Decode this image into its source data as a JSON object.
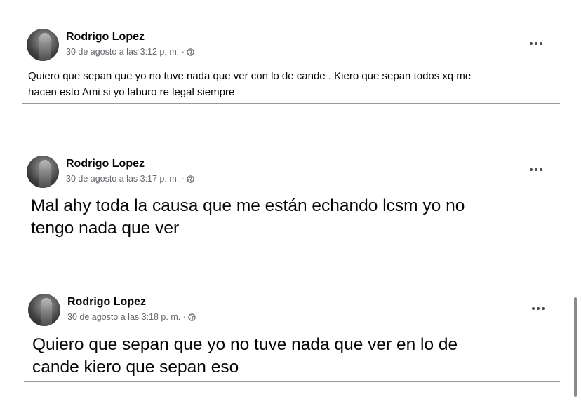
{
  "posts": [
    {
      "author": "Rodrigo Lopez",
      "timestamp": "30 de agosto a las 3:12 p. m. ·",
      "privacy_icon": "globe-icon",
      "text_line1": "Quiero que sepan que yo no tuve nada que ver con lo de cande . Kiero que sepan todos xq me",
      "text_line2": "hacen esto Ami si yo laburo re legal siempre"
    },
    {
      "author": "Rodrigo Lopez",
      "timestamp": "30 de agosto a las 3:17 p. m. ·",
      "privacy_icon": "globe-icon",
      "text_line1": "Mal ahy toda la causa que me están echando lcsm yo no",
      "text_line2": "tengo nada que ver"
    },
    {
      "author": "Rodrigo Lopez",
      "timestamp": "30 de agosto a las 3:18 p. m. ·",
      "privacy_icon": "globe-icon",
      "text_line1": "Quiero que sepan que yo no tuve nada que ver en lo de",
      "text_line2": "cande kiero que sepan eso"
    }
  ],
  "more_icon": "more-options-icon",
  "colors": {
    "text": "#050505",
    "meta": "#65676b",
    "divider": "#9a9a9a"
  }
}
